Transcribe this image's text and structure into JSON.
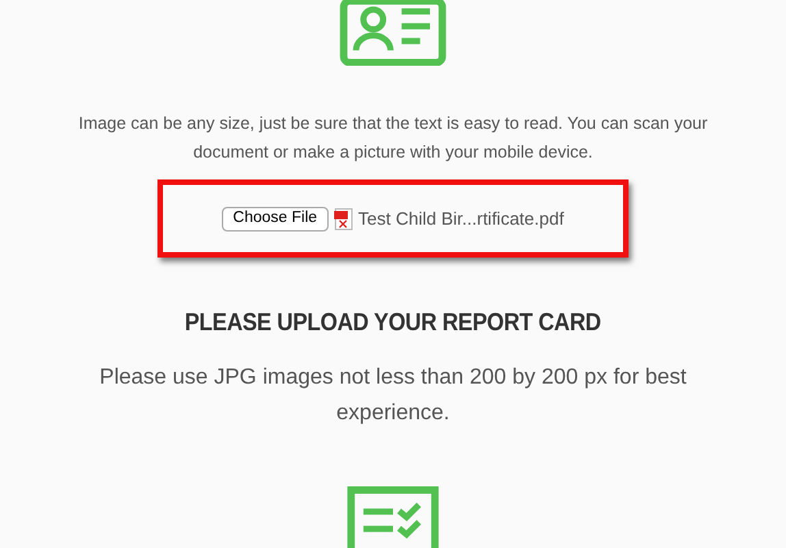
{
  "intro": "Image can be any size, just be sure that the text is easy to read. You can scan your document or make a picture with your mobile device.",
  "upload": {
    "button": "Choose File",
    "file_name": "Test Child Bir...rtificate.pdf",
    "highlighted": true
  },
  "section": {
    "title": "PLEASE UPLOAD YOUR REPORT CARD",
    "description": "Please use JPG images not less than 200 by 200 px for best experience."
  }
}
